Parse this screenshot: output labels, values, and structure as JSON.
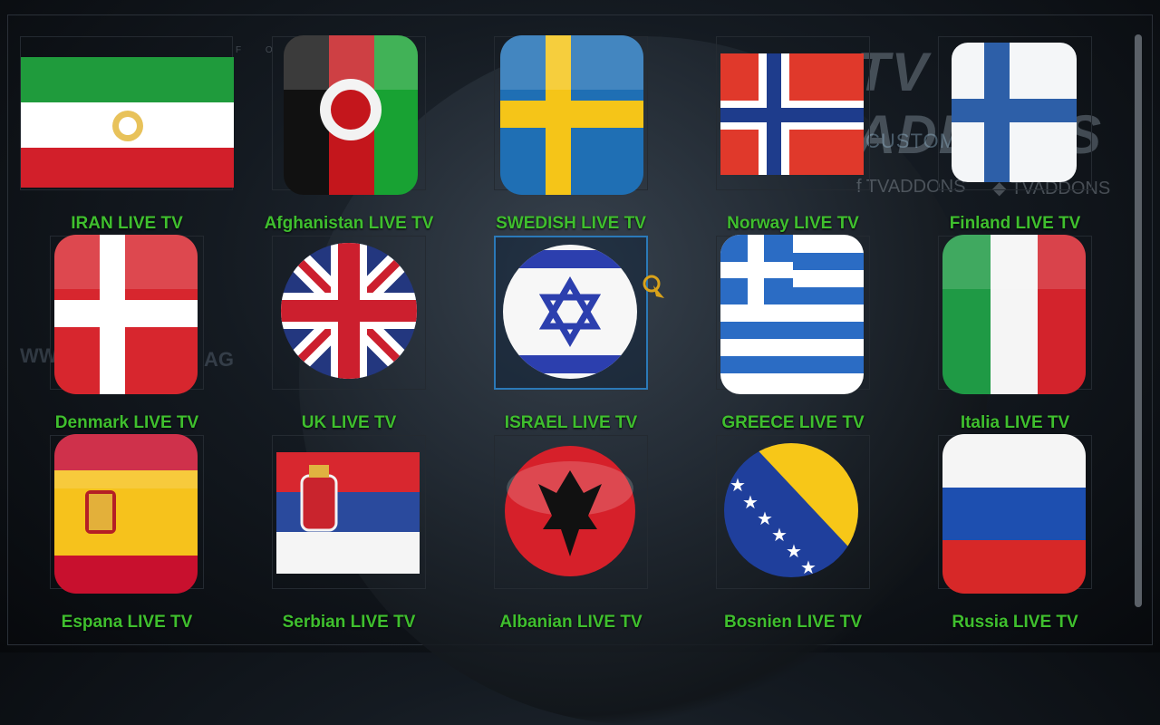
{
  "background": {
    "brand_logo": "TV ADDONS",
    "brand_tagline": "CUSTOMIZATION",
    "social_facebook": "TVADDONS",
    "social_twitter": "TVADDONS",
    "watermark_left": "WW",
    "watermark_right": "AG",
    "header_faint": "F   O   N"
  },
  "accent_color": "#3fbf2e",
  "selected_index": 7,
  "tiles": [
    {
      "label": "IRAN LIVE TV",
      "flag": "iran-flag"
    },
    {
      "label": "Afghanistan LIVE TV",
      "flag": "afghanistan-flag"
    },
    {
      "label": "SWEDISH LIVE TV",
      "flag": "sweden-flag"
    },
    {
      "label": "Norway LIVE TV",
      "flag": "norway-flag"
    },
    {
      "label": "Finland LIVE TV",
      "flag": "finland-flag"
    },
    {
      "label": "Denmark LIVE TV",
      "flag": "denmark-flag"
    },
    {
      "label": "UK LIVE TV",
      "flag": "uk-flag"
    },
    {
      "label": "ISRAEL LIVE TV",
      "flag": "israel-flag"
    },
    {
      "label": "GREECE LIVE TV",
      "flag": "greece-flag"
    },
    {
      "label": "Italia LIVE TV",
      "flag": "italy-flag"
    },
    {
      "label": "Espana LIVE TV",
      "flag": "spain-flag"
    },
    {
      "label": "Serbian LIVE TV",
      "flag": "serbia-flag"
    },
    {
      "label": "Albanian LIVE TV",
      "flag": "albania-flag"
    },
    {
      "label": "Bosnien LIVE TV",
      "flag": "bosnia-flag"
    },
    {
      "label": "Russia LIVE TV",
      "flag": "russia-flag"
    }
  ]
}
